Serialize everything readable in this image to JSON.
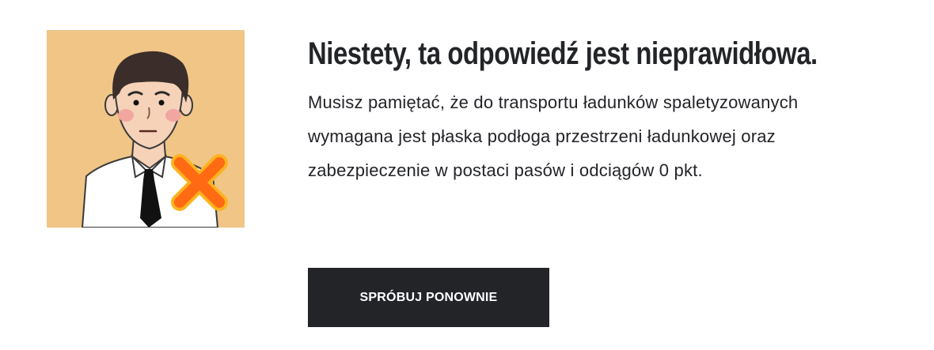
{
  "feedback": {
    "title": "Niestety, ta odpowiedź jest nieprawidłowa.",
    "message_lines": [
      "Musisz pamiętać, że do transportu ładunków spaletyzowanych",
      "wymagana jest płaska podłoga przestrzeni ładunkowej oraz",
      "zabezpieczenie w postaci pasów i odciągów 0 pkt."
    ]
  },
  "actions": {
    "retry_label": "SPRÓBUJ PONOWNIE"
  },
  "illustration": {
    "icon": "wrong-answer-icon",
    "background_color": "#f0c586",
    "cross_color": "#ff6a13"
  },
  "colors": {
    "text": "#232428",
    "button_bg": "#232428",
    "button_text": "#ffffff"
  }
}
